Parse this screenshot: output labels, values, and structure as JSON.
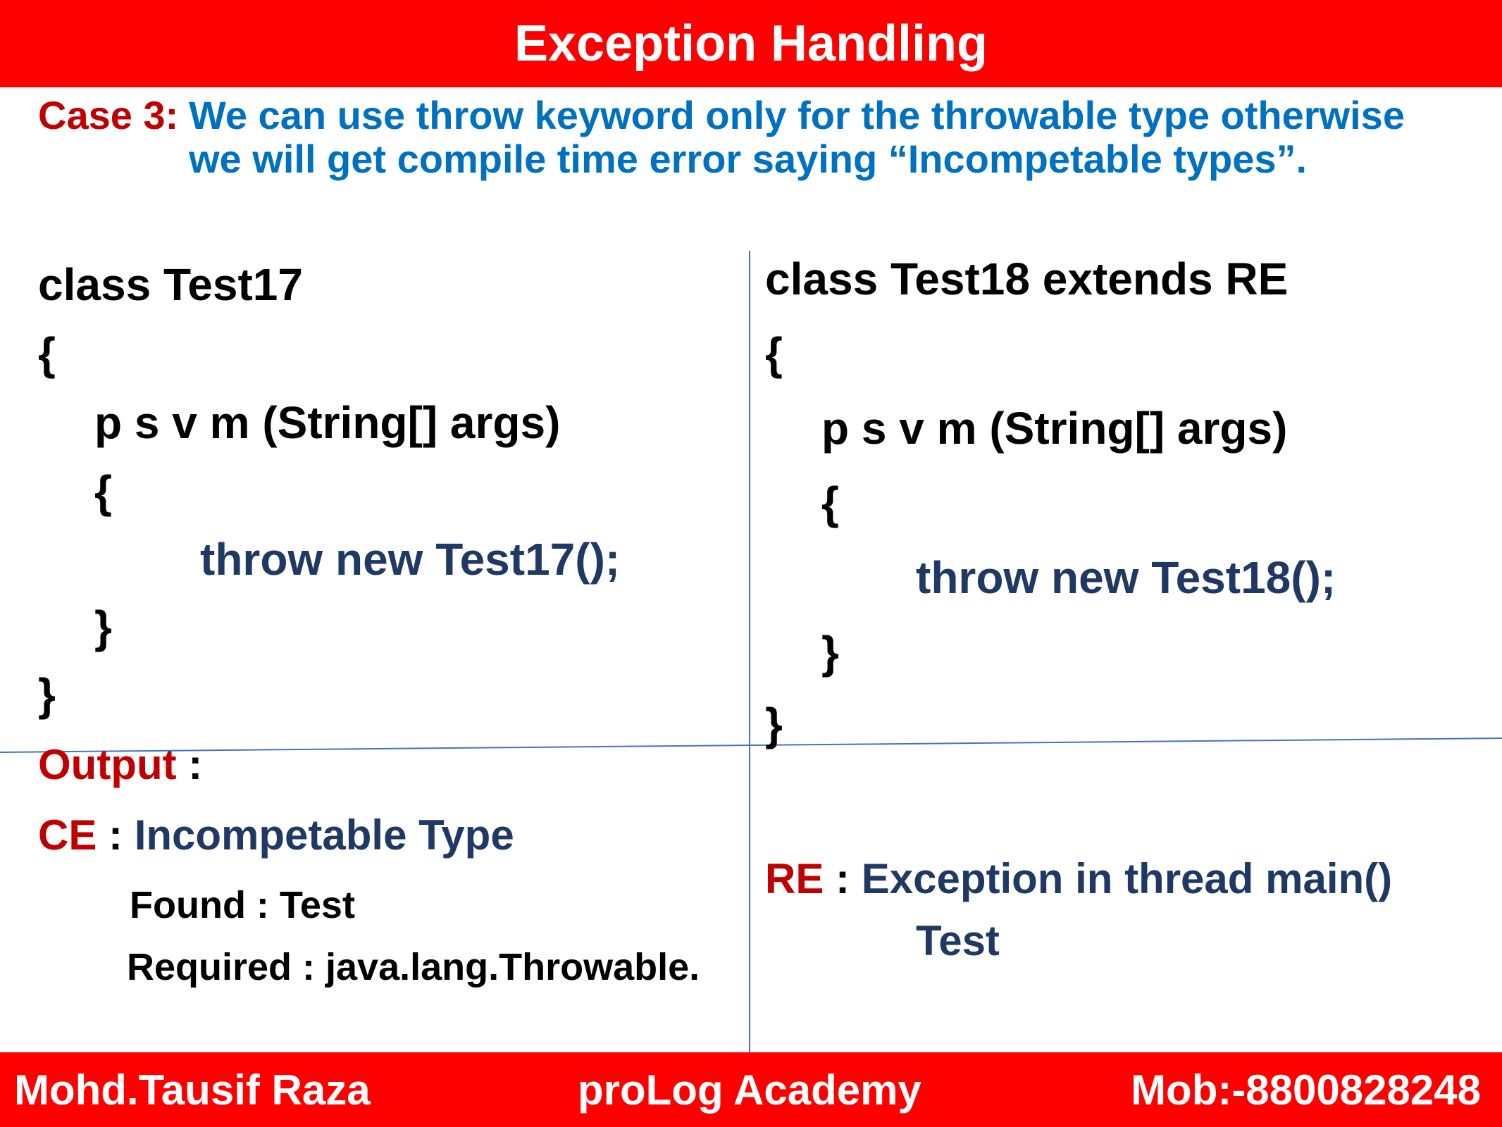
{
  "header": {
    "title": "Exception Handling"
  },
  "case": {
    "label": "Case 3:",
    "line1": "We can use throw keyword only for the throwable type otherwise",
    "line2": "we will get compile time error saying “Incompetable types”."
  },
  "left_code": {
    "line1": "class Test17",
    "line2": "{",
    "line3": "p s v m (String[] args)",
    "line4": "{",
    "line5": "throw new Test17();",
    "line6": "}",
    "line7": "}"
  },
  "right_code": {
    "line1": "class Test18 extends RE",
    "line2": "{",
    "line3": "p s v m (String[] args)",
    "line4": "{",
    "line5": "throw new Test18();",
    "line6": "}",
    "line7": "}"
  },
  "left_output": {
    "label": "Output",
    "colon": " :",
    "ce_label": "CE",
    "ce_colon": " : ",
    "ce_text": "Incompetable Type",
    "found": "Found : Test",
    "required": "Required : java.lang.Throwable."
  },
  "right_output": {
    "re_label": "RE",
    "re_colon": " :  ",
    "re_text": "Exception in thread main()",
    "re_text2": "Test"
  },
  "footer": {
    "author": "Mohd.Tausif Raza",
    "academy": "proLog Academy",
    "mobile": "Mob:-8800828248"
  },
  "colors": {
    "banner": "#ff0000",
    "case_label": "#c00000",
    "case_text": "#0070c0",
    "accent_navy": "#1f3864",
    "divider": "#4472c4"
  }
}
